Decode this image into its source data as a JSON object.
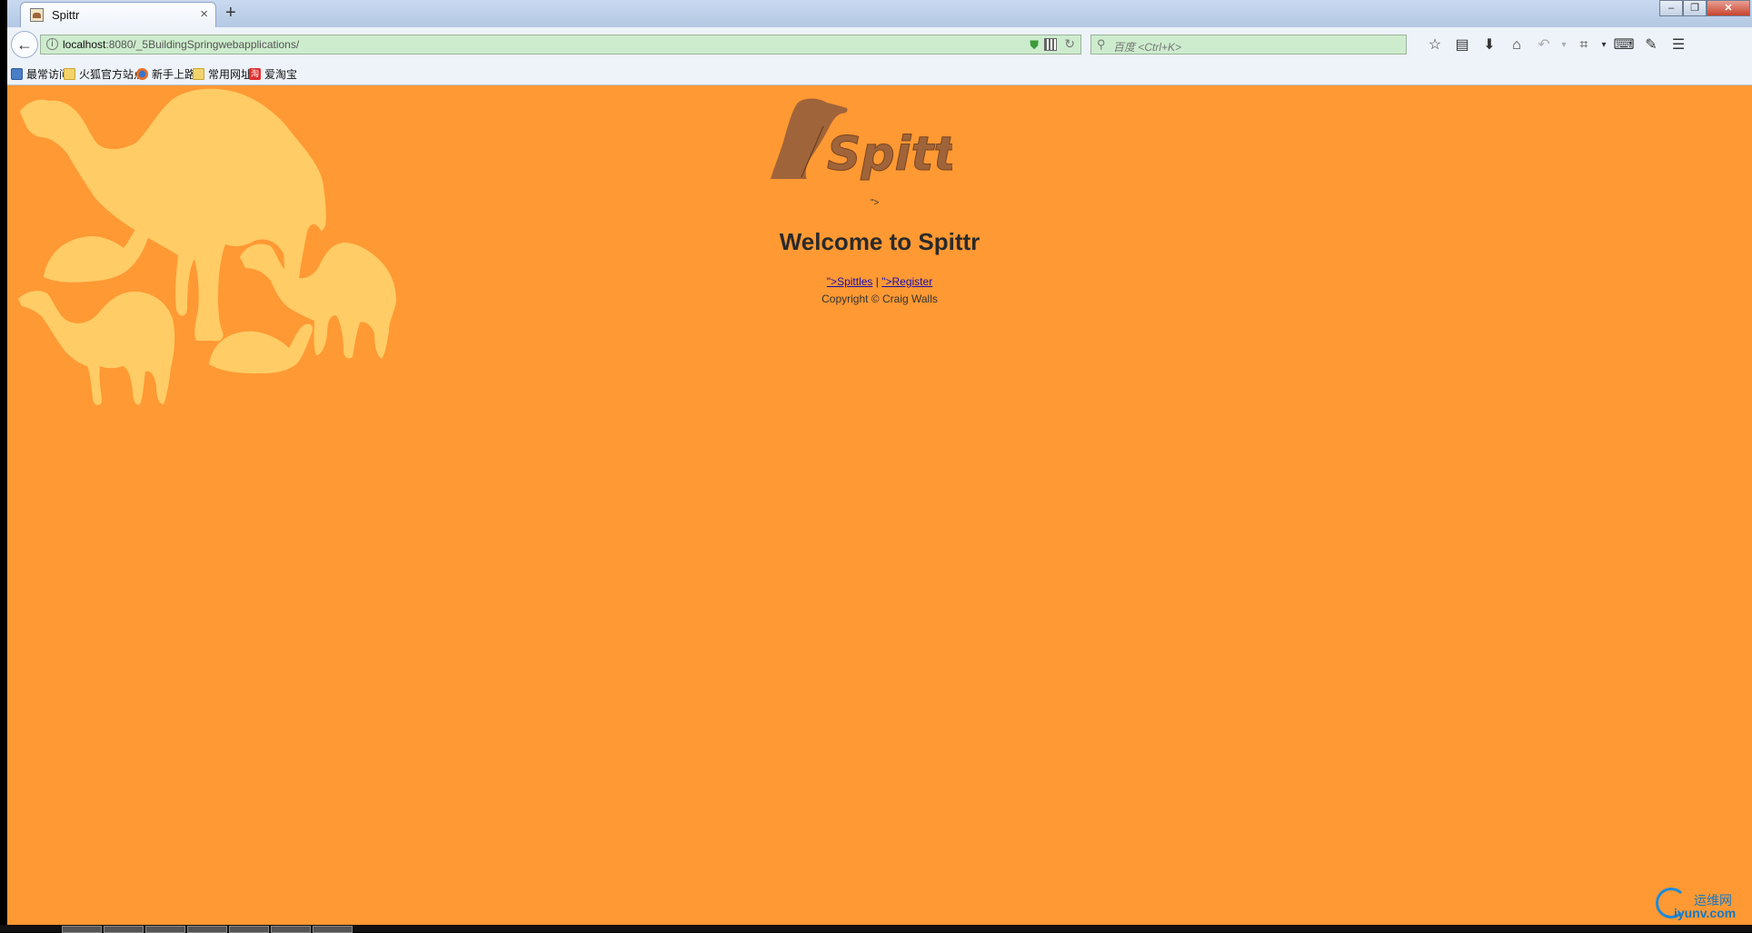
{
  "browser": {
    "tab_title": "Spittr",
    "tab_close": "×",
    "new_tab": "+",
    "url_host": "localhost",
    "url_path": ":8080/_5BuildingSpringwebapplications/",
    "search_placeholder": "百度 <Ctrl+K>",
    "bookmarks": [
      "最常访问",
      "火狐官方站点",
      "新手上路",
      "常用网址",
      "爱淘宝"
    ],
    "bookmark_taobao_badge": "淘"
  },
  "page": {
    "logo_text": "Spittr",
    "logo_alt": "\">",
    "heading": "Welcome to Spittr",
    "link_spittles": "\">Spittles",
    "separator": "|",
    "link_register": "\">Register",
    "copyright": "Copyright © Craig Walls"
  },
  "watermark": {
    "line1": "运维网",
    "line2": "iyunv.com"
  },
  "colors": {
    "page_background": "#ff9933",
    "camel_fill": "#ffcc66",
    "logo_brown": "#a0643a",
    "link": "#1a0dab"
  },
  "icons": [
    "back-arrow-icon",
    "info-icon",
    "shield-icon",
    "qr-code-icon",
    "reload-icon",
    "search-icon",
    "star-icon",
    "reading-list-icon",
    "download-icon",
    "home-icon",
    "undo-icon",
    "screenshot-icon",
    "keyboard-icon",
    "chat-icon",
    "menu-icon"
  ]
}
